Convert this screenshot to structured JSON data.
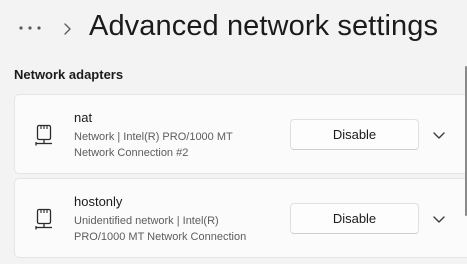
{
  "header": {
    "more_icon": "more-horizontal-icon",
    "breadcrumb_chevron_icon": "chevron-right-icon",
    "title": "Advanced network settings"
  },
  "section": {
    "heading": "Network adapters"
  },
  "adapters": [
    {
      "name": "nat",
      "description_lines": [
        "Network | Intel(R) PRO/1000 MT",
        "Network Connection #2"
      ],
      "action_label": "Disable",
      "icon": "network-adapter-icon",
      "expand_icon": "chevron-down-icon"
    },
    {
      "name": "hostonly",
      "description_lines": [
        "Unidentified network | Intel(R)",
        "PRO/1000 MT Network Connection"
      ],
      "action_label": "Disable",
      "icon": "network-adapter-icon",
      "expand_icon": "chevron-down-icon"
    }
  ],
  "colors": {
    "background": "#f3f3f3",
    "card": "#fbfbfb",
    "text_primary": "#1b1b1b",
    "text_secondary": "#5d5d5d"
  }
}
